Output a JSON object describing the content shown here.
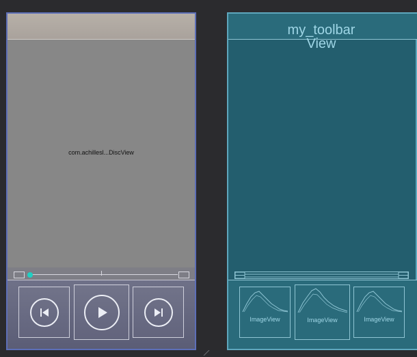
{
  "design": {
    "disc_view_label": "com.achillesl...DiscView",
    "accent_color": "#1fd0c3",
    "controls": {
      "prev_icon": "skip-previous-icon",
      "play_icon": "play-icon",
      "next_icon": "skip-next-icon"
    }
  },
  "blueprint": {
    "toolbar_label": "my_toolbar",
    "view_label": "View",
    "image_views": [
      "ImageView",
      "ImageView",
      "ImageView"
    ],
    "line_color": "#8fc5d4"
  }
}
